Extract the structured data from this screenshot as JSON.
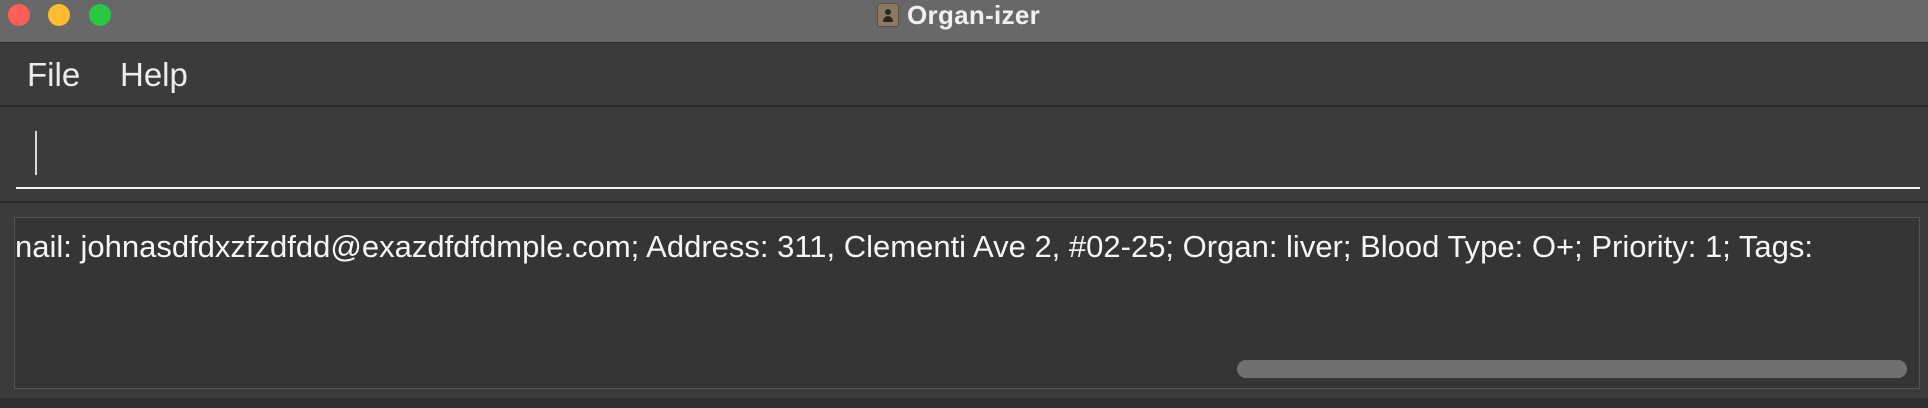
{
  "window": {
    "title": "Organ-izer",
    "icon": "contact-card-icon"
  },
  "menu": {
    "items": [
      {
        "label": "File"
      },
      {
        "label": "Help"
      }
    ]
  },
  "command": {
    "value": "",
    "placeholder": ""
  },
  "result": {
    "text": "nail: johnasdfdxzfzdfdd@exazdfdfdmple.com; Address: 311, Clementi Ave 2, #02-25; Organ: liver; Blood Type: O+; Priority: 1; Tags:"
  },
  "colors": {
    "titlebar": "#686868",
    "background": "#3b3b3b",
    "result_background": "#353535",
    "text": "#f6f6f6",
    "close": "#fe5f57",
    "minimize": "#febc2e",
    "maximize": "#28c840"
  }
}
